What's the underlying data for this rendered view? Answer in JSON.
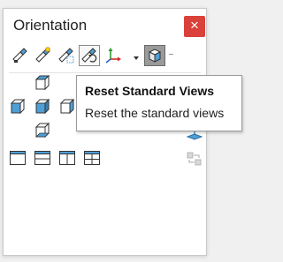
{
  "panel": {
    "title": "Orientation",
    "close_glyph": "×"
  },
  "toolbar": {
    "buttons": [
      {
        "icon": "new-view-icon"
      },
      {
        "icon": "update-view-icon"
      },
      {
        "icon": "zoom-to-fit-view-icon"
      },
      {
        "icon": "reset-standard-views-icon",
        "state": "hover"
      },
      {
        "icon": "triad-axes-icon",
        "has_dropdown": true
      },
      {
        "icon": "view-selector-cube-icon",
        "state": "active"
      }
    ]
  },
  "tooltip": {
    "title": "Reset Standard Views",
    "description": "Reset the standard views"
  },
  "colors": {
    "close_button": "#d9413a",
    "cube_face_highlight": "#4f9fd6",
    "tooltip_border": "#9a9a9a"
  }
}
